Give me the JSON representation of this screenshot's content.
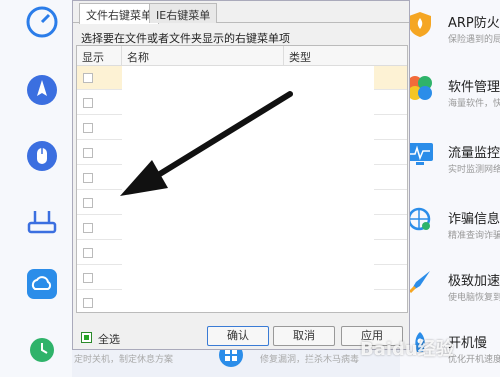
{
  "dialog": {
    "tabs": [
      {
        "label": "文件右键菜单",
        "active": true
      },
      {
        "label": "IE右键菜单",
        "active": false
      }
    ],
    "hint": "选择要在文件或者文件夹显示的右键菜单项",
    "columns": {
      "show": "显示",
      "name": "名称",
      "type": "类型"
    },
    "select_all_label": "全选",
    "buttons": {
      "ok": "确认",
      "cancel": "取消",
      "apply": "应用"
    }
  },
  "right_panel": {
    "items": [
      {
        "title": "ARP防火墙",
        "subtitle": "保险遇到的局域网"
      },
      {
        "title": "软件管理",
        "subtitle": "海量软件，快速"
      },
      {
        "title": "流量监控",
        "subtitle": "实时监测网络"
      },
      {
        "title": "诈骗信息过",
        "subtitle": "精准查询诈骗"
      },
      {
        "title": "极致加速",
        "subtitle": "使电脑恢复到"
      },
      {
        "title": "开机慢",
        "subtitle": "优化开机速度"
      }
    ]
  },
  "bottom_captions": {
    "left": "定时关机，制定休息方案",
    "mid": "修复漏洞，拦杀木马病毒"
  },
  "watermark": "Baidu经验",
  "colors": {
    "accent": "#3a7bd5",
    "highlight_row": "#fdf2d4",
    "checkbox_green": "#27a527"
  }
}
